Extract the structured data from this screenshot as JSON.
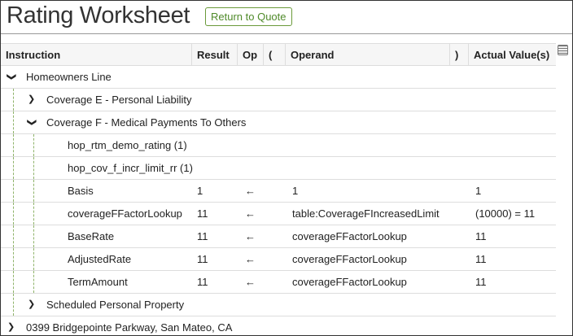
{
  "title": "Rating Worksheet",
  "return_button": "Return to Quote",
  "columns": [
    "Instruction",
    "Result",
    "Op",
    "(",
    "Operand",
    ")",
    "Actual Value(s)"
  ],
  "rows": [
    {
      "label": "Homeowners Line",
      "level": 0,
      "chevron": "down"
    },
    {
      "label": "Coverage E - Personal Liability",
      "level": 1,
      "chevron": "right"
    },
    {
      "label": "Coverage F - Medical Payments To Others",
      "level": 1,
      "chevron": "down"
    },
    {
      "label": "hop_rtm_demo_rating (1)",
      "level": 2
    },
    {
      "label": "hop_cov_f_incr_limit_rr (1)",
      "level": 2
    },
    {
      "label": "Basis",
      "level": 2,
      "result": "1",
      "op": "←",
      "operand": "1",
      "actual": "1"
    },
    {
      "label": "coverageFFactorLookup",
      "level": 2,
      "result": "11",
      "op": "←",
      "operand": "table:CoverageFIncreasedLimit",
      "actual": "(10000) = 11"
    },
    {
      "label": "BaseRate",
      "level": 2,
      "result": "11",
      "op": "←",
      "operand": "coverageFFactorLookup",
      "actual": "11"
    },
    {
      "label": "AdjustedRate",
      "level": 2,
      "result": "11",
      "op": "←",
      "operand": "coverageFFactorLookup",
      "actual": "11"
    },
    {
      "label": "TermAmount",
      "level": 2,
      "result": "11",
      "op": "←",
      "operand": "coverageFFactorLookup",
      "actual": "11"
    },
    {
      "label": "Scheduled Personal Property",
      "level": 1,
      "chevron": "right"
    },
    {
      "label": "0399 Bridgepointe Parkway, San Mateo, CA",
      "level": 0,
      "chevron": "right"
    }
  ],
  "icons": {
    "column_picker": "table-grid-icon"
  },
  "colors": {
    "accent": "#4f8a2a",
    "tree_line": "#8fb36a"
  }
}
